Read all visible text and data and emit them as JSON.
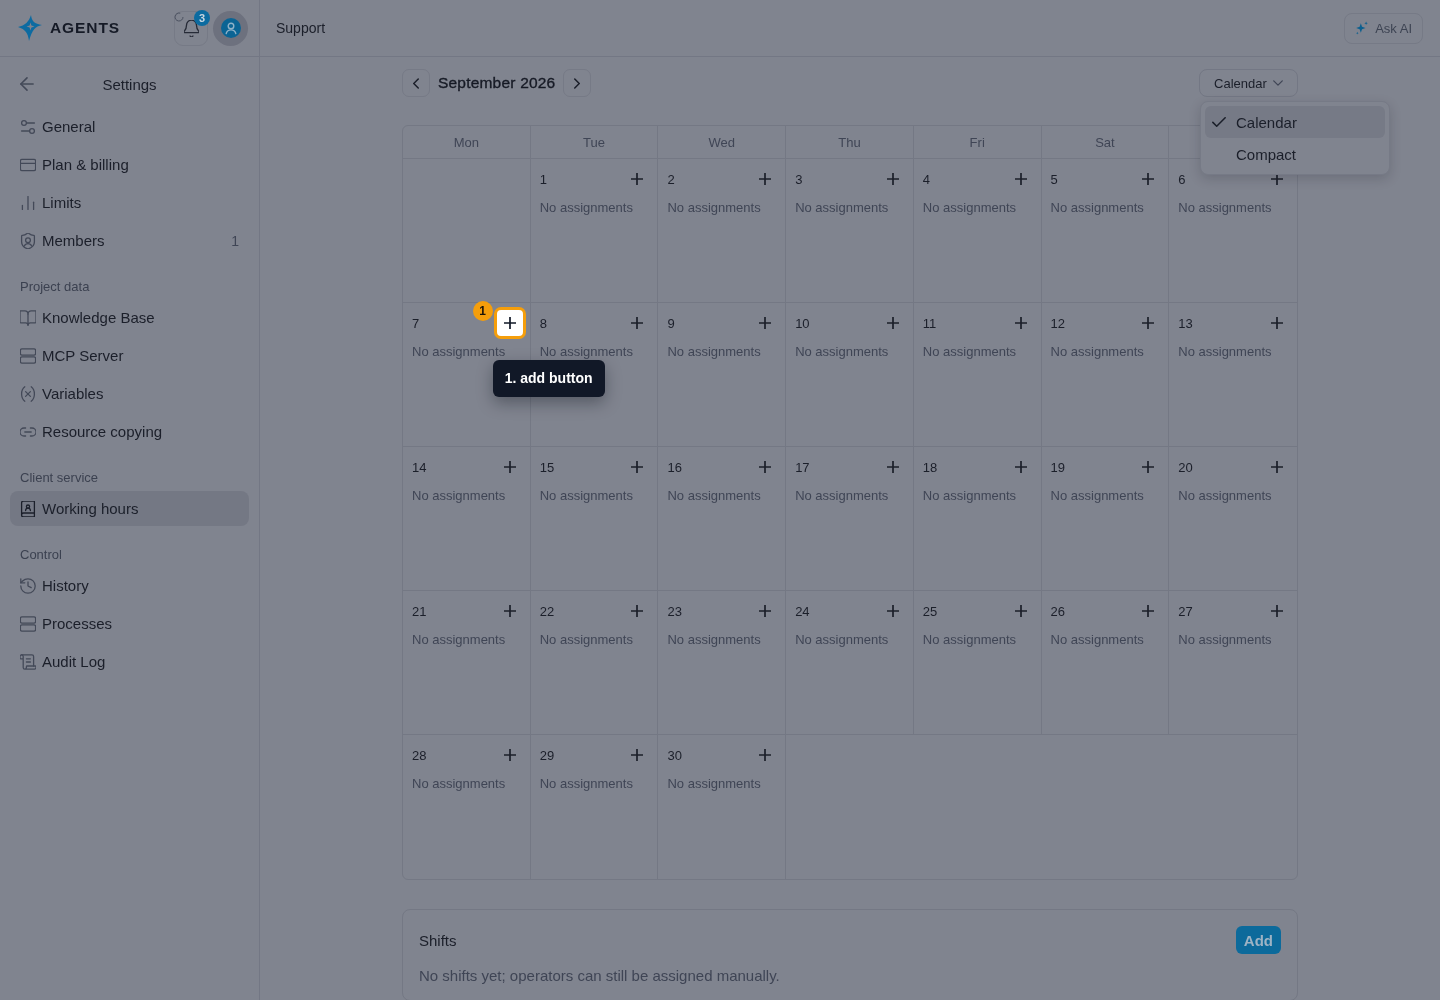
{
  "header": {
    "brand": "AGENTS",
    "notifications": {
      "count": "3"
    },
    "page_title": "Support",
    "ask_ai": "Ask AI"
  },
  "sidebar": {
    "title": "Settings",
    "sections": [
      {
        "items": [
          {
            "label": "General",
            "selected": false
          },
          {
            "label": "Plan & billing",
            "selected": false
          },
          {
            "label": "Limits",
            "selected": false
          },
          {
            "label": "Members",
            "count": "1",
            "selected": false
          }
        ]
      },
      {
        "heading": "Project data",
        "items": [
          {
            "label": "Knowledge Base",
            "selected": false
          },
          {
            "label": "MCP Server",
            "selected": false
          },
          {
            "label": "Variables",
            "selected": false
          },
          {
            "label": "Resource copying",
            "selected": false
          }
        ]
      },
      {
        "heading": "Client service",
        "items": [
          {
            "label": "Working hours",
            "selected": true
          }
        ]
      },
      {
        "heading": "Control",
        "items": [
          {
            "label": "History",
            "selected": false
          },
          {
            "label": "Processes",
            "selected": false
          },
          {
            "label": "Audit Log",
            "selected": false
          }
        ]
      }
    ]
  },
  "toolbar": {
    "month": "September 2026",
    "view": {
      "value": "Calendar",
      "expanded": true,
      "options": [
        {
          "label": "Calendar",
          "selected": true
        },
        {
          "label": "Compact",
          "selected": false
        }
      ]
    }
  },
  "calendar": {
    "weekdays": [
      "Mon",
      "Tue",
      "Wed",
      "Thu",
      "Fri",
      "Sat"
    ],
    "weeks": [
      {
        "days": [
          {
            "kind": "empty"
          },
          {
            "kind": "day",
            "date": "1",
            "note": "No assignments"
          },
          {
            "kind": "day",
            "date": "2",
            "note": "No assignments"
          },
          {
            "kind": "day",
            "date": "3",
            "note": "No assignments"
          },
          {
            "kind": "day",
            "date": "4",
            "note": "No assignments"
          },
          {
            "kind": "day",
            "date": "5",
            "note": "No assignments"
          },
          {
            "kind": "day",
            "date": "6",
            "note": "No assignments"
          }
        ]
      },
      {
        "days": [
          {
            "kind": "day",
            "date": "7",
            "note": "No assignments",
            "annotation": {
              "marker": "1",
              "label": "1. add button"
            }
          },
          {
            "kind": "day",
            "date": "8",
            "note": "No assignments"
          },
          {
            "kind": "day",
            "date": "9",
            "note": "No assignments"
          },
          {
            "kind": "day",
            "date": "10",
            "note": "No assignments"
          },
          {
            "kind": "day",
            "date": "11",
            "note": "No assignments"
          },
          {
            "kind": "day",
            "date": "12",
            "note": "No assignments"
          },
          {
            "kind": "day",
            "date": "13",
            "note": "No assignments"
          }
        ]
      },
      {
        "days": [
          {
            "kind": "day",
            "date": "14",
            "note": "No assignments"
          },
          {
            "kind": "day",
            "date": "15",
            "note": "No assignments"
          },
          {
            "kind": "day",
            "date": "16",
            "note": "No assignments"
          },
          {
            "kind": "day",
            "date": "17",
            "note": "No assignments"
          },
          {
            "kind": "day",
            "date": "18",
            "note": "No assignments"
          },
          {
            "kind": "day",
            "date": "19",
            "note": "No assignments"
          },
          {
            "kind": "day",
            "date": "20",
            "note": "No assignments"
          }
        ]
      },
      {
        "days": [
          {
            "kind": "day",
            "date": "21",
            "note": "No assignments"
          },
          {
            "kind": "day",
            "date": "22",
            "note": "No assignments"
          },
          {
            "kind": "day",
            "date": "23",
            "note": "No assignments"
          },
          {
            "kind": "day",
            "date": "24",
            "note": "No assignments"
          },
          {
            "kind": "day",
            "date": "25",
            "note": "No assignments"
          },
          {
            "kind": "day",
            "date": "26",
            "note": "No assignments"
          },
          {
            "kind": "day",
            "date": "27",
            "note": "No assignments"
          }
        ]
      },
      {
        "days": [
          {
            "kind": "day",
            "date": "28",
            "note": "No assignments"
          },
          {
            "kind": "day",
            "date": "29",
            "note": "No assignments"
          },
          {
            "kind": "day",
            "date": "30",
            "note": "No assignments"
          }
        ]
      }
    ]
  },
  "shifts": {
    "title": "Shifts",
    "add_label": "Add",
    "empty_text": "No shifts yet; operators can still be assigned manually."
  }
}
